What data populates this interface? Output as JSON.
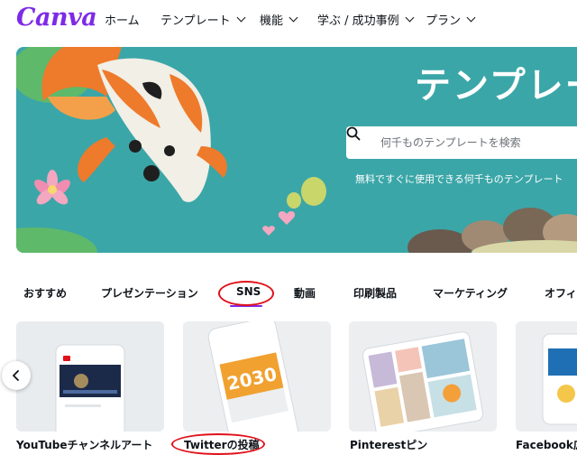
{
  "brand": {
    "logo_text": "Canva",
    "brand_color": "#7d2ae8"
  },
  "nav": {
    "items": [
      {
        "label": "ホーム",
        "has_dropdown": false
      },
      {
        "label": "テンプレート",
        "has_dropdown": true
      },
      {
        "label": "機能",
        "has_dropdown": true
      },
      {
        "label": "学ぶ / 成功事例",
        "has_dropdown": true
      },
      {
        "label": "プラン",
        "has_dropdown": true
      }
    ]
  },
  "hero": {
    "title": "テンプレー",
    "search_placeholder": "何千ものテンプレートを検索",
    "subtitle": "無料ですぐに使用できる何千ものテンプレート",
    "background_color": "#3ba6a8"
  },
  "categories": {
    "tabs": [
      {
        "label": "おすすめ"
      },
      {
        "label": "プレゼンテーション"
      },
      {
        "label": "SNS",
        "selected": true
      },
      {
        "label": "動画"
      },
      {
        "label": "印刷製品"
      },
      {
        "label": "マーケティング"
      },
      {
        "label": "オフィ"
      }
    ],
    "highlight_color": "#e0111b"
  },
  "templates": {
    "cards": [
      {
        "label": "YouTubeチャンネルアート"
      },
      {
        "label": "Twitterの投稿",
        "card_text": "2030"
      },
      {
        "label": "Pinterestピン"
      },
      {
        "label": "Facebook広"
      }
    ]
  }
}
